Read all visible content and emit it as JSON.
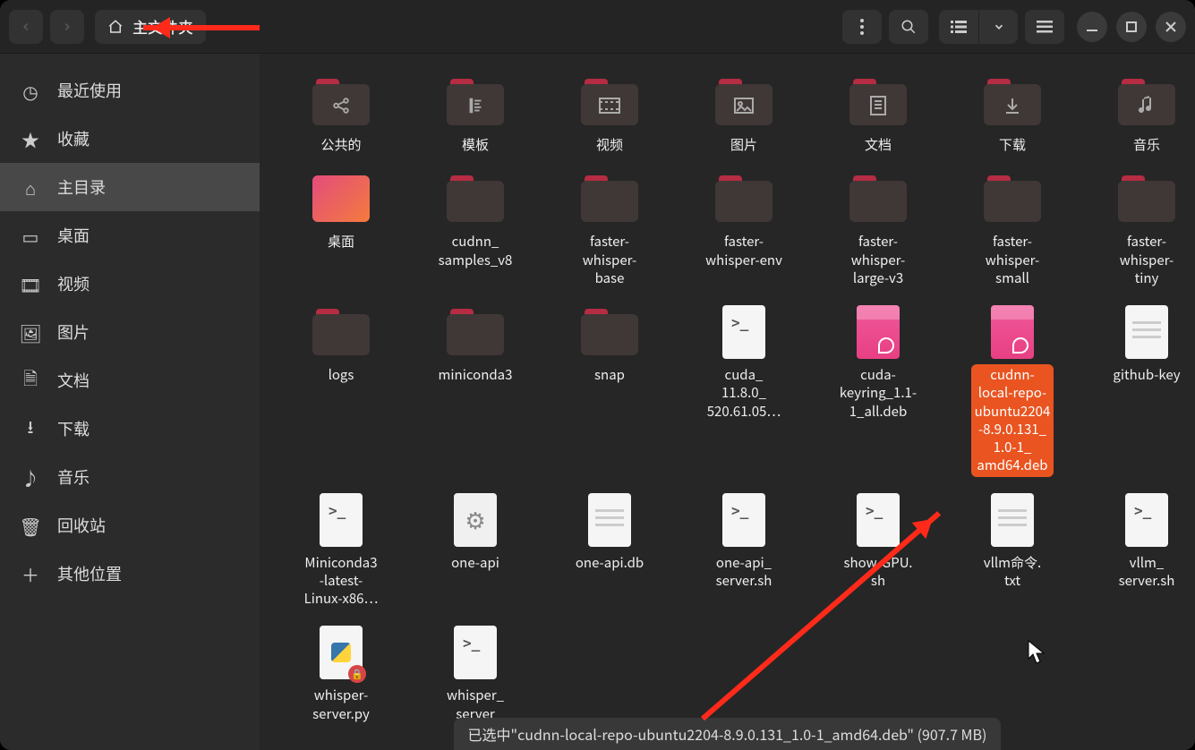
{
  "header": {
    "path_label": "主文件夹"
  },
  "sidebar": {
    "items": [
      {
        "label": "最近使用"
      },
      {
        "label": "收藏"
      },
      {
        "label": "主目录"
      },
      {
        "label": "桌面"
      },
      {
        "label": "视频"
      },
      {
        "label": "图片"
      },
      {
        "label": "文档"
      },
      {
        "label": "下载"
      },
      {
        "label": "音乐"
      },
      {
        "label": "回收站"
      },
      {
        "label": "其他位置"
      }
    ]
  },
  "grid": {
    "items": [
      {
        "label": "公共的",
        "type": "folder",
        "glyph": "share"
      },
      {
        "label": "模板",
        "type": "folder",
        "glyph": "ruler"
      },
      {
        "label": "视频",
        "type": "folder",
        "glyph": "video"
      },
      {
        "label": "图片",
        "type": "folder",
        "glyph": "image"
      },
      {
        "label": "文档",
        "type": "folder",
        "glyph": "doc"
      },
      {
        "label": "下载",
        "type": "folder",
        "glyph": "download"
      },
      {
        "label": "音乐",
        "type": "folder",
        "glyph": "music"
      },
      {
        "label": "桌面",
        "type": "desktop"
      },
      {
        "label": "cudnn_\nsamples_v8",
        "type": "folder"
      },
      {
        "label": "faster-\nwhisper-\nbase",
        "type": "folder"
      },
      {
        "label": "faster-\nwhisper-env",
        "type": "folder"
      },
      {
        "label": "faster-\nwhisper-\nlarge-v3",
        "type": "folder"
      },
      {
        "label": "faster-\nwhisper-\nsmall",
        "type": "folder"
      },
      {
        "label": "faster-\nwhisper-\ntiny",
        "type": "folder"
      },
      {
        "label": "logs",
        "type": "folder"
      },
      {
        "label": "miniconda3",
        "type": "folder"
      },
      {
        "label": "snap",
        "type": "folder"
      },
      {
        "label": "cuda_\n11.8.0_\n520.61.05…",
        "type": "term"
      },
      {
        "label": "cuda-\nkeyring_1.1-\n1_all.deb",
        "type": "deb"
      },
      {
        "label": "cudnn-\nlocal-repo-\nubuntu2204\n-8.9.0.131_\n1.0-1_\namd64.deb",
        "type": "deb",
        "selected": true
      },
      {
        "label": "github-key",
        "type": "doc"
      },
      {
        "label": "Miniconda3\n-latest-\nLinux-x86…",
        "type": "term"
      },
      {
        "label": "one-api",
        "type": "gear"
      },
      {
        "label": "one-api.db",
        "type": "doc"
      },
      {
        "label": "one-api_\nserver.sh",
        "type": "term"
      },
      {
        "label": "show-GPU.\nsh",
        "type": "term"
      },
      {
        "label": "vllm命令.\ntxt",
        "type": "doc"
      },
      {
        "label": "vllm_\nserver.sh",
        "type": "term"
      },
      {
        "label": "whisper-\nserver.py",
        "type": "py-locked"
      },
      {
        "label": "whisper_\nserver",
        "type": "term"
      }
    ]
  },
  "statusbar": {
    "text": "已选中\"cudnn-local-repo-ubuntu2204-8.9.0.131_1.0-1_amd64.deb\" (907.7 MB)"
  }
}
